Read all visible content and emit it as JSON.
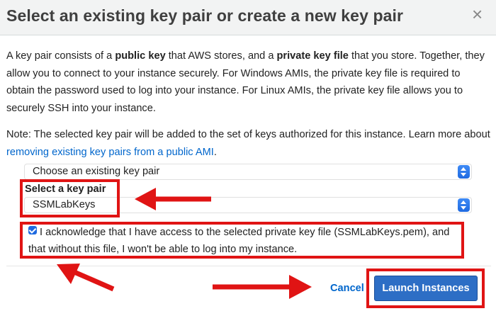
{
  "dialog": {
    "title": "Select an existing key pair or create a new key pair",
    "close_glyph": "×"
  },
  "intro": {
    "t1": "A key pair consists of a ",
    "b1": "public key",
    "t2": " that AWS stores, and a ",
    "b2": "private key file",
    "t3": " that you store. Together, they allow you to connect to your instance securely. For Windows AMIs, the private key file is required to obtain the password used to log into your instance. For Linux AMIs, the private key file allows you to securely SSH into your instance."
  },
  "note": {
    "text": "Note: The selected key pair will be added to the set of keys authorized for this instance. Learn more about ",
    "link": "removing existing key pairs from a public AMI",
    "end": "."
  },
  "key_pair_option": {
    "selected": "Choose an existing key pair"
  },
  "key_pair": {
    "label": "Select a key pair",
    "selected": "SSMLabKeys"
  },
  "acknowledge": {
    "checked": true,
    "text": "I acknowledge that I have access to the selected private key file (SSMLabKeys.pem), and that without this file, I won't be able to log into my instance."
  },
  "footer": {
    "cancel": "Cancel",
    "launch": "Launch Instances"
  },
  "annotations": {
    "color": "#e01414"
  },
  "icons": {
    "close": "close-icon",
    "select_arrows": "select-stepper-icon",
    "checkbox": "check-icon",
    "arrows": "arrow-icon"
  }
}
